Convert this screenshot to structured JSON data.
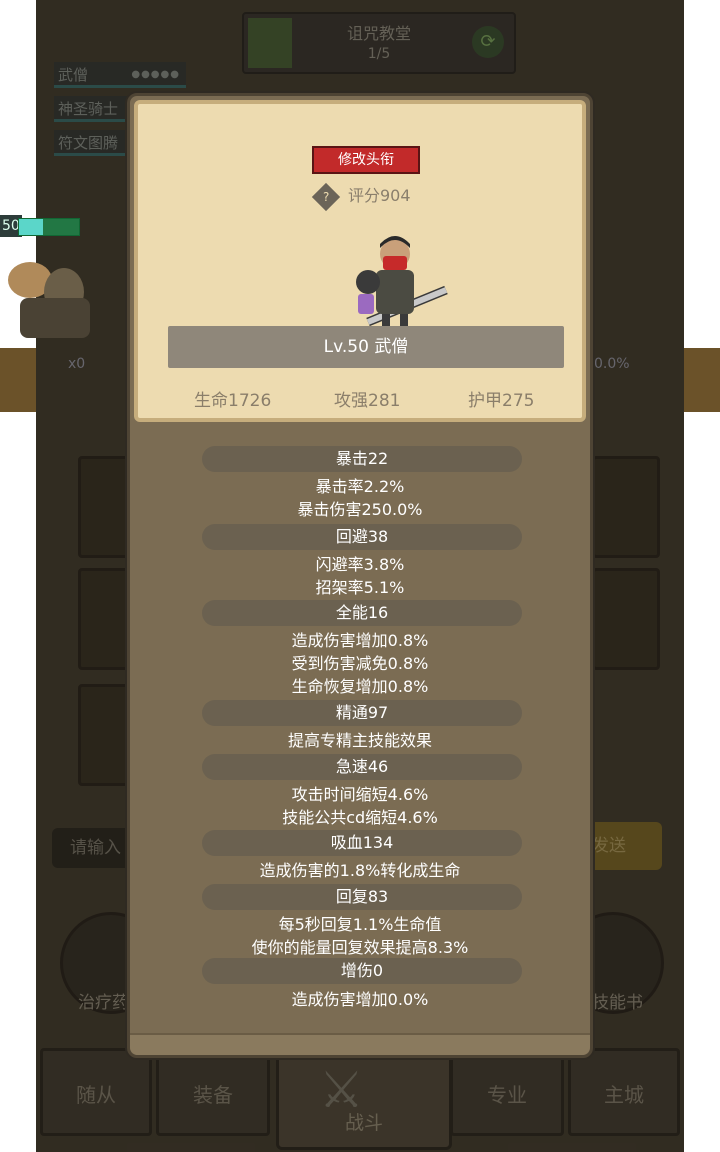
{
  "dungeon": {
    "name": "诅咒教堂",
    "progress": "1/5"
  },
  "party": [
    {
      "name": "武僧",
      "dots": "●●●●●"
    },
    {
      "name": "神圣骑士"
    },
    {
      "name": "符文图腾"
    }
  ],
  "battle": {
    "hp_number": "50",
    "multiplier": "x0",
    "percent": "0.0%"
  },
  "chat": {
    "input_placeholder": "请输入",
    "send_label": "发送"
  },
  "side_buttons": {
    "left": "治疗药",
    "right": "技能书"
  },
  "nav": {
    "followers": "随从",
    "equipment": "装备",
    "battle": "战斗",
    "profession": "专业",
    "main_city": "主城"
  },
  "profile": {
    "title_button": "修改头衔",
    "score_icon": "?",
    "score": "评分904",
    "level_name": "Lv.50 武僧",
    "hp": "生命1726",
    "attack": "攻强281",
    "armor": "护甲275"
  },
  "stats": {
    "crit": {
      "header": "暴击22",
      "lines": [
        "暴击率2.2%",
        "暴击伤害250.0%"
      ]
    },
    "dodge": {
      "header": "回避38",
      "lines": [
        "闪避率3.8%",
        "招架率5.1%"
      ]
    },
    "versatility": {
      "header": "全能16",
      "lines": [
        "造成伤害增加0.8%",
        "受到伤害减免0.8%",
        "生命恢复增加0.8%"
      ]
    },
    "mastery": {
      "header": "精通97",
      "lines": [
        "提高专精主技能效果"
      ]
    },
    "haste": {
      "header": "急速46",
      "lines": [
        "攻击时间缩短4.6%",
        "技能公共cd缩短4.6%"
      ]
    },
    "leech": {
      "header": "吸血134",
      "lines": [
        "造成伤害的1.8%转化成生命"
      ]
    },
    "regen": {
      "header": "回复83",
      "lines": [
        "每5秒回复1.1%生命值",
        "使你的能量回复效果提高8.3%"
      ]
    },
    "dmg_bonus": {
      "header": "增伤0",
      "lines": [
        "造成伤害增加0.0%"
      ]
    }
  }
}
